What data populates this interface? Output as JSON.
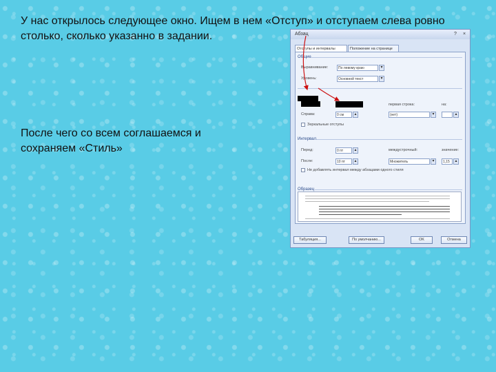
{
  "slide": {
    "text_top": "У нас открылось следующее окно. Ищем в нем «Отступ» и отступаем слева ровно столько, сколько указанно в задании.",
    "text_bottom": "После чего со всем соглашаемся и сохраняем «Стиль»"
  },
  "colors": {
    "background": "#59cce6",
    "arrow": "#cc1111",
    "dialog_frame": "#7b95c4"
  },
  "icons": {
    "help": "help-icon",
    "close": "close-icon",
    "dropdown": "chevron-down-icon",
    "spin": "spinner-icon"
  },
  "dialog": {
    "title": "Абзац",
    "help_glyph": "?",
    "close_glyph": "×",
    "tabs": [
      "Отступы и интервалы",
      "Положение на странице"
    ],
    "group_general": "Общие",
    "label_alignment": "Выравнивание:",
    "value_alignment": "По левому краю",
    "label_level": "Уровень:",
    "value_level": "Основной текст",
    "label_first_line": "первая строка:",
    "label_by": "на:",
    "label_right": "Справа:",
    "value_right": "0 см",
    "value_first_line": "(нет)",
    "checkbox_mirror": "Зеркальные отступы",
    "group_spacing": "Интервал",
    "label_before": "Перед:",
    "value_before": "0 пт",
    "label_after": "После:",
    "value_after": "10 пт",
    "label_line_spacing": "междустрочный:",
    "value_line_spacing": "Множитель",
    "label_value": "значение:",
    "value_value": "1,15",
    "checkbox_no_space": "Не добавлять интервал между абзацами одного стиля",
    "group_preview": "Образец",
    "button_tab": "Табуляция...",
    "button_default": "По умолчанию...",
    "button_ok": "OK",
    "button_cancel": "Отмена"
  }
}
